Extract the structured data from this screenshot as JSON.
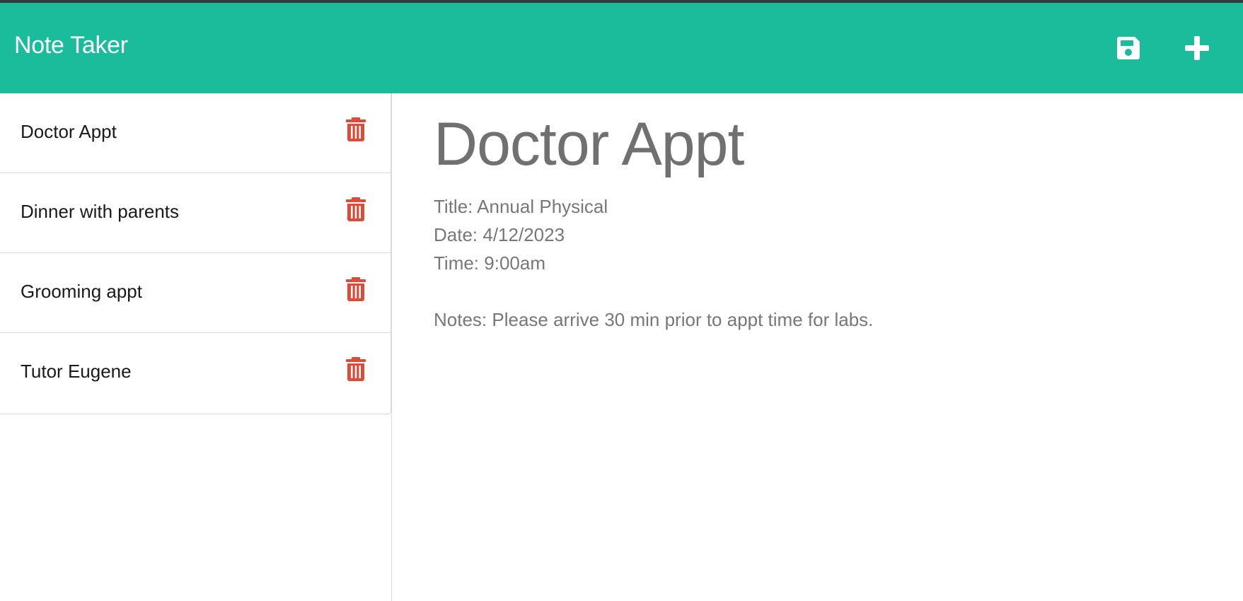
{
  "app": {
    "title": "Note Taker",
    "accent_color": "#1abc9c",
    "danger_color": "#dd4b39"
  },
  "toolbar": {
    "save_icon": "save-icon",
    "new_icon": "plus-icon"
  },
  "notes": [
    {
      "title": "Doctor Appt"
    },
    {
      "title": "Dinner with parents"
    },
    {
      "title": "Grooming appt"
    },
    {
      "title": "Tutor Eugene"
    }
  ],
  "active_note": {
    "title": "Doctor Appt",
    "text": "Title: Annual Physical\nDate: 4/12/2023\nTime: 9:00am\n\nNotes: Please arrive 30 min prior to appt time for labs."
  }
}
